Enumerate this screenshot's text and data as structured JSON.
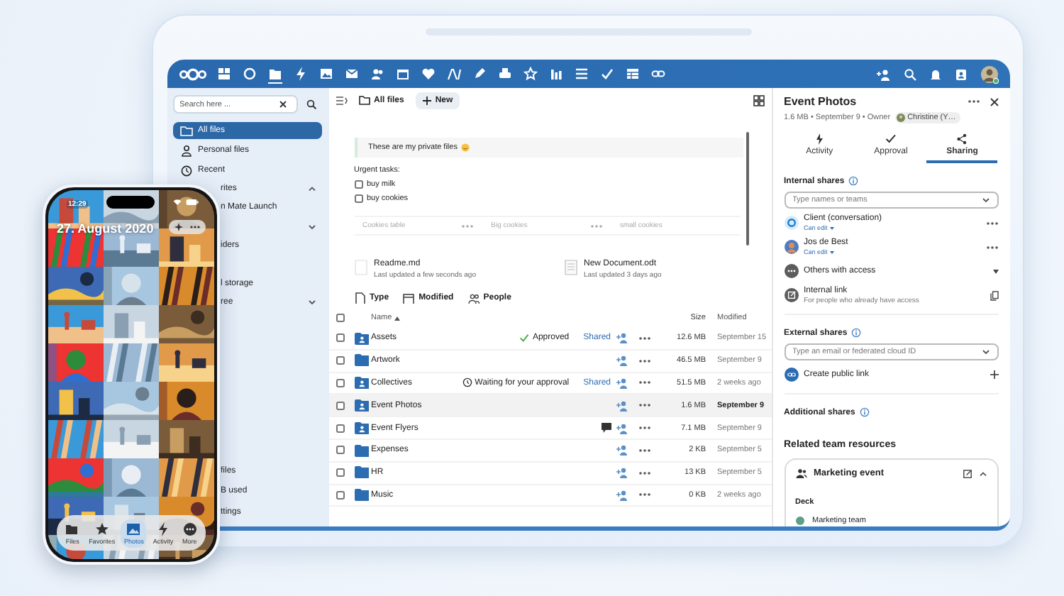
{
  "topbar": {
    "apps": [
      {
        "kind": "dashboard",
        "selected": false
      },
      {
        "kind": "talk",
        "selected": false
      },
      {
        "kind": "files",
        "selected": true
      },
      {
        "kind": "activity",
        "selected": false
      },
      {
        "kind": "photos",
        "selected": false
      },
      {
        "kind": "mail",
        "selected": false
      },
      {
        "kind": "contacts",
        "selected": false
      },
      {
        "kind": "calendar",
        "selected": false
      },
      {
        "kind": "heart",
        "selected": false
      },
      {
        "kind": "text",
        "selected": false
      },
      {
        "kind": "pencil",
        "selected": false
      },
      {
        "kind": "printer",
        "selected": false
      },
      {
        "kind": "star",
        "selected": false
      },
      {
        "kind": "chart",
        "selected": false
      },
      {
        "kind": "list",
        "selected": false
      },
      {
        "kind": "check",
        "selected": false
      },
      {
        "kind": "table",
        "selected": false
      },
      {
        "kind": "link",
        "selected": false
      }
    ]
  },
  "sidebar": {
    "search_placeholder": "Search here ...",
    "items": [
      {
        "kind": "nav",
        "label": "All files",
        "selected": true
      },
      {
        "kind": "nav",
        "label": "Personal files",
        "selected": false
      },
      {
        "kind": "nav",
        "label": "Recent",
        "selected": false
      },
      {
        "kind": "group",
        "label": "rites",
        "expanded": true
      },
      {
        "kind": "child",
        "label": "n Mate Launch"
      },
      {
        "kind": "group",
        "expanded": false
      },
      {
        "kind": "child",
        "label": "iders"
      }
    ],
    "lower_items": [
      {
        "kind": "child",
        "label": "l storage"
      },
      {
        "kind": "group",
        "label": "ree",
        "expanded": false
      }
    ],
    "footer_items": [
      {
        "label": "files"
      },
      {
        "label": "B used"
      },
      {
        "label": "ttings"
      }
    ]
  },
  "files": {
    "breadcrumb": "All files",
    "new_button": "New",
    "note": {
      "callout": "These are my private files",
      "heading": "Urgent tasks:",
      "tasks": [
        {
          "label": "buy milk",
          "checked": false
        },
        {
          "label": "buy cookies",
          "checked": false
        }
      ],
      "table_cells": [
        "Cookies table",
        "Big cookies",
        "small cookies"
      ]
    },
    "recent": [
      {
        "name": "Readme.md",
        "updated": "Last updated a few seconds ago"
      },
      {
        "name": "New Document.odt",
        "updated": "Last updated 3 days ago"
      }
    ],
    "filters": [
      "Type",
      "Modified",
      "People"
    ],
    "columns": [
      "Name",
      "Size",
      "Modified"
    ],
    "select_all_checked": false,
    "rows": [
      {
        "kind": "team",
        "name": "Assets",
        "status": {
          "kind": "approved",
          "label": "Approved"
        },
        "shared": "Shared",
        "comment": false,
        "size": "12.6 MB",
        "modified": "September 15",
        "checked": false,
        "active": false
      },
      {
        "kind": "plain",
        "name": "Artwork",
        "comment": false,
        "size": "46.5 MB",
        "modified": "September 9",
        "checked": false,
        "active": false
      },
      {
        "kind": "team",
        "name": "Collectives",
        "status": {
          "kind": "pending",
          "label": "Waiting for your approval"
        },
        "shared": "Shared",
        "comment": false,
        "size": "51.5 MB",
        "modified": "2 weeks ago",
        "checked": false,
        "active": false
      },
      {
        "kind": "team",
        "name": "Event Photos",
        "comment": false,
        "size": "1.6 MB",
        "modified": "September 9",
        "checked": false,
        "active": true
      },
      {
        "kind": "team",
        "name": "Event Flyers",
        "comment": true,
        "size": "7.1 MB",
        "modified": "September 9",
        "checked": false,
        "active": false
      },
      {
        "kind": "plain",
        "name": "Expenses",
        "comment": false,
        "size": "2 KB",
        "modified": "September 5",
        "checked": false,
        "active": false
      },
      {
        "kind": "plain",
        "name": "HR",
        "comment": false,
        "size": "13 KB",
        "modified": "September 5",
        "checked": false,
        "active": false
      },
      {
        "kind": "plain",
        "name": "Music",
        "comment": false,
        "size": "0 KB",
        "modified": "2 weeks ago",
        "checked": false,
        "active": false
      }
    ]
  },
  "details": {
    "title": "Event Photos",
    "meta": "1.6 MB • September 9 • Owner",
    "owner": "Christine (Y…",
    "tabs": [
      {
        "kind": "activity",
        "label": "Activity",
        "selected": false
      },
      {
        "kind": "approval",
        "label": "Approval",
        "selected": false
      },
      {
        "kind": "sharing",
        "label": "Sharing",
        "selected": true
      }
    ],
    "internal": {
      "heading": "Internal shares",
      "placeholder": "Type names or teams",
      "shares": [
        {
          "kind": "conversation",
          "name": "Client (conversation)",
          "permission": "Can edit"
        },
        {
          "kind": "user",
          "name": "Jos de Best",
          "permission": "Can edit"
        }
      ],
      "others": "Others with access",
      "link_title": "Internal link",
      "link_hint": "For people who already have access"
    },
    "external": {
      "heading": "External shares",
      "placeholder": "Type an email or federated cloud ID",
      "create": "Create public link"
    },
    "additional": "Additional shares",
    "related": {
      "heading": "Related team resources",
      "team": "Marketing event",
      "sections": [
        {
          "title": "Deck",
          "items": [
            {
              "label": "Marketing team",
              "color": "#5e9e84"
            }
          ]
        }
      ]
    }
  },
  "phone": {
    "time": "12:29",
    "date": "27. August 2020",
    "nav": [
      {
        "kind": "files",
        "label": "Files",
        "selected": false
      },
      {
        "kind": "favorites",
        "label": "Favorites",
        "selected": false
      },
      {
        "kind": "photos",
        "label": "Photos",
        "selected": true
      },
      {
        "kind": "activity",
        "label": "Activity",
        "selected": false
      },
      {
        "kind": "more",
        "label": "More",
        "selected": false
      }
    ]
  }
}
